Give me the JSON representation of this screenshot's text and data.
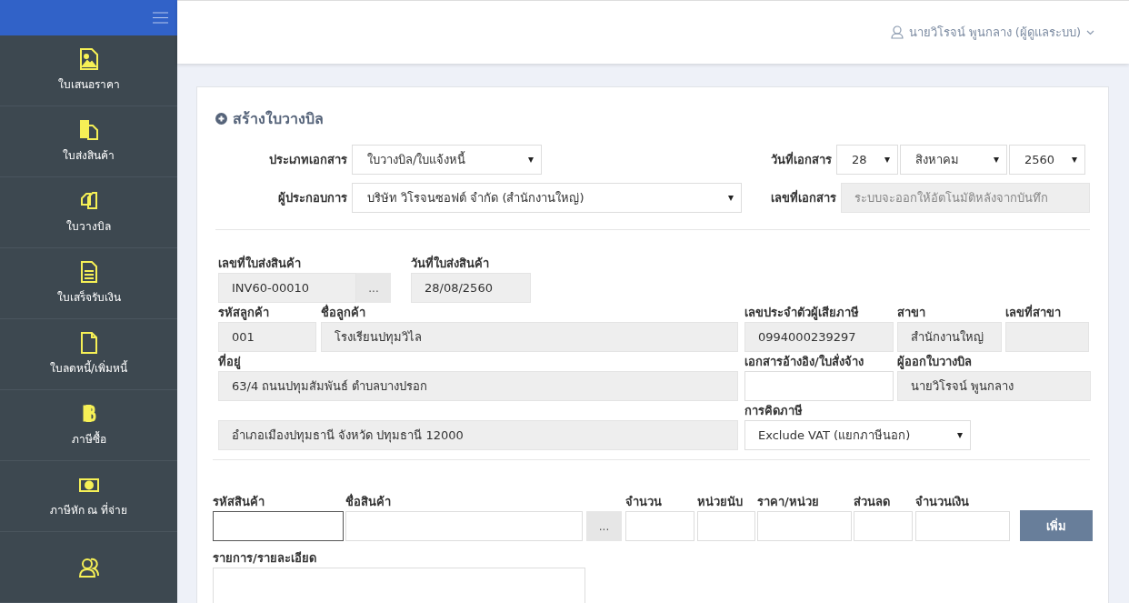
{
  "header": {
    "user": "นายวิโรจน์ พูนกลาง (ผู้ดูแลระบบ)"
  },
  "sidebar": {
    "items": [
      {
        "label": "ใบเสนอราคา",
        "kind": "picture"
      },
      {
        "label": "ใบส่งสินค้า",
        "kind": "copy"
      },
      {
        "label": "ใบวางบิล",
        "kind": "copies"
      },
      {
        "label": "ใบเสร็จรับเงิน",
        "kind": "text"
      },
      {
        "label": "ใบลดหนี้/เพิ่มหนี้",
        "kind": "blank"
      },
      {
        "label": "ภาษีซื้อ",
        "kind": "bitcoin"
      },
      {
        "label": "ภาษีหัก ณ ที่จ่าย",
        "kind": "money"
      },
      {
        "kind": "users"
      }
    ]
  },
  "form": {
    "title": "สร้างใบวางบิล",
    "document_type": {
      "label": "ประเภทเอกสาร",
      "value": "ใบวางบิล/ใบแจ้งหนี้"
    },
    "operator": {
      "label": "ผู้ประกอบการ",
      "value": "บริษัท วิโรจนซอฟต์ จำกัด (สำนักงานใหญ่)"
    },
    "document_date": {
      "label": "วันที่เอกสาร",
      "day": "28",
      "month": "สิงหาคม",
      "year": "2560"
    },
    "document_number": {
      "label": "เลขที่เอกสาร",
      "placeholder": "ระบบจะออกให้อัตโนมัติหลังจากบันทึก"
    },
    "invoice_number": {
      "label": "เลขที่ใบส่งสินค้า",
      "value": "INV60-00010",
      "button": "..."
    },
    "invoice_date": {
      "label": "วันที่ใบส่งสินค้า",
      "value": "28/08/2560"
    },
    "customer_code": {
      "label": "รหัสลูกค้า",
      "value": "001"
    },
    "customer_name": {
      "label": "ชื่อลูกค้า",
      "value": "โรงเรียนปทุมวิไล"
    },
    "tax_id": {
      "label": "เลขประจำตัวผู้เสียภาษี",
      "value": "0994000239297"
    },
    "branch": {
      "label": "สาขา",
      "value": "สำนักงานใหญ่"
    },
    "branch_number": {
      "label": "เลขที่สาขา"
    },
    "address": {
      "label": "ที่อยู่",
      "value": "63/4 ถนนปทุมสัมพันธ์ ตำบลบางปรอก"
    },
    "reference": {
      "label": "เอกสารอ้างอิง/ใบสั่งจ้าง"
    },
    "issuer": {
      "label": "ผู้ออกใบวางบิล",
      "value": "นายวิโรจน์ พูนกลาง"
    },
    "address_line_2": {
      "value": "อำเภอเมืองปทุมธานี จังหวัด ปทุมธานี 12000"
    },
    "tax_calculation": {
      "label": "การคิดภาษี",
      "value": "Exclude VAT (แยกภาษีนอก)"
    }
  },
  "line_item": {
    "product_code": {
      "label": "รหัสสินค้า"
    },
    "product_name": {
      "label": "ชื่อสินค้า"
    },
    "lookup_button": "...",
    "quantity": {
      "label": "จำนวน"
    },
    "unit": {
      "label": "หน่วยนับ"
    },
    "unit_price": {
      "label": "ราคา/หน่วย"
    },
    "discount": {
      "label": "ส่วนลด"
    },
    "amount": {
      "label": "จำนวนเงิน"
    },
    "add_button": "เพิ่ม",
    "details": {
      "label": "รายการ/รายละเอียด"
    }
  }
}
